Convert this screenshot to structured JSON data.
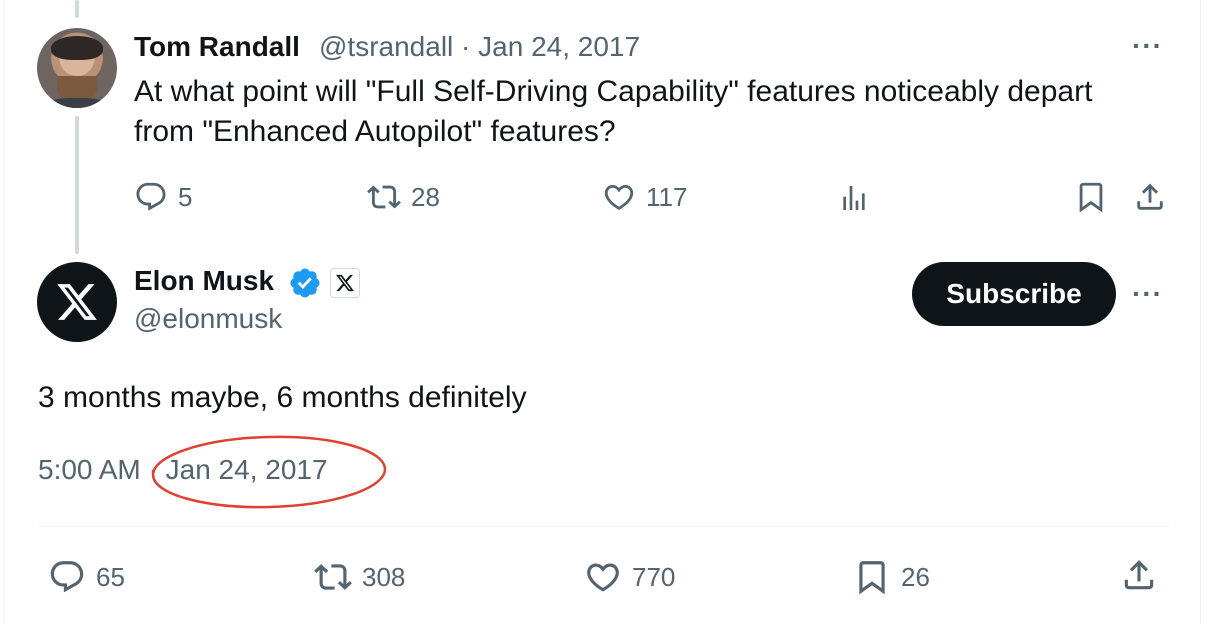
{
  "reply_tweet": {
    "author_name": "Tom Randall",
    "author_handle": "@tsrandall",
    "separator": "·",
    "date": "Jan 24, 2017",
    "text_line1": "At what point will \"Full Self-Driving Capability\" features noticeably depart",
    "text_line2": "from \"Enhanced Autopilot\" features?",
    "more_label": "···",
    "actions": {
      "replies": "5",
      "reposts": "28",
      "likes": "117"
    },
    "icons": [
      "reply-icon",
      "repost-icon",
      "like-icon",
      "views-icon",
      "bookmark-icon",
      "share-icon"
    ]
  },
  "main_tweet": {
    "author_name": "Elon Musk",
    "author_handle": "@elonmusk",
    "subscribe_label": "Subscribe",
    "more_label": "···",
    "text": "3 months maybe, 6 months definitely",
    "time": "5:00 AM",
    "separator": "·",
    "date": "Jan 24, 2017",
    "actions": {
      "replies": "65",
      "reposts": "308",
      "likes": "770",
      "bookmarks": "26"
    },
    "icons": [
      "reply-icon",
      "repost-icon",
      "like-icon",
      "bookmark-icon",
      "share-icon",
      "verified-badge-icon",
      "x-logo-icon"
    ]
  },
  "colors": {
    "text_primary": "#0f1419",
    "text_secondary": "#536471",
    "verified_blue": "#1d9bf0",
    "annotation_red": "#e0412f",
    "thread_line": "#cfd9de"
  }
}
